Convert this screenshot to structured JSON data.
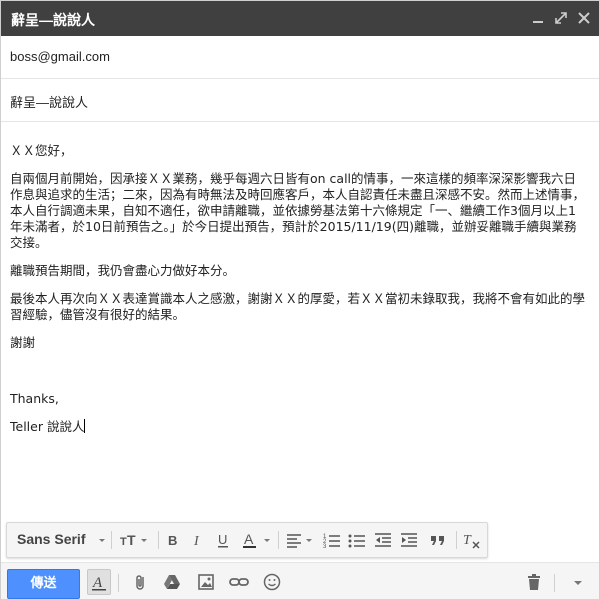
{
  "window": {
    "title": "辭呈—說說人"
  },
  "fields": {
    "to_value": "boss@gmail.com",
    "subject_value": "辭呈—說說人"
  },
  "body": {
    "greeting": "ＸＸ您好，",
    "para1": "自兩個月前開始，因承接ＸＸ業務，幾乎每週六日皆有on call的情事，一來這樣的頻率深深影響我六日作息與追求的生活；二來，因為有時無法及時回應客戶，本人自認責任未盡且深感不安。然而上述情事，本人自行調適未果，自知不適任，欲申請離職，並依據勞基法第十六條規定「一、繼續工作3個月以上1年未滿者，於10日前預告之。」於今日提出預告，預計於2015/11/19(四)離職，並辦妥離職手續與業務交接。",
    "para2": "離職預告期間，我仍會盡心力做好本分。",
    "para3": "最後本人再次向ＸＸ表達賞識本人之感激，謝謝ＸＸ的厚愛，若ＸＸ當初未錄取我，我將不會有如此的學習經驗，儘管沒有很好的結果。",
    "para4": "謝謝",
    "thanks": "Thanks,",
    "signature": "Teller 說說人"
  },
  "format_toolbar": {
    "font_family": "Sans Serif"
  },
  "bottom_toolbar": {
    "send_label": "傳送"
  },
  "colors": {
    "titlebar": "#404040",
    "send_button": "#4d90fe"
  },
  "icons": [
    "minimize-icon",
    "expand-icon",
    "close-icon",
    "font-size-icon",
    "bold-icon",
    "italic-icon",
    "underline-icon",
    "text-color-icon",
    "align-icon",
    "numbered-list-icon",
    "bulleted-list-icon",
    "indent-less-icon",
    "indent-more-icon",
    "quote-icon",
    "remove-formatting-icon",
    "formatting-options-icon",
    "attach-icon",
    "drive-icon",
    "photo-icon",
    "link-icon",
    "emoji-icon",
    "trash-icon",
    "more-options-icon"
  ]
}
